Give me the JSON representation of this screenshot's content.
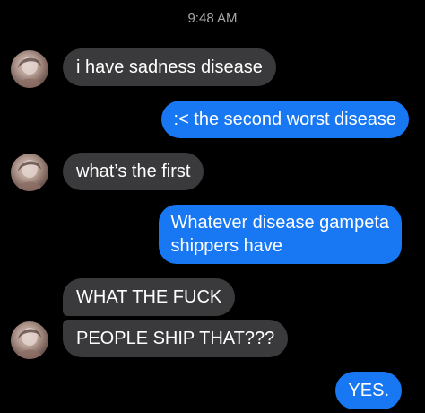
{
  "conversation": {
    "timestamp": "9:48 AM",
    "messages": [
      {
        "sender": "them",
        "text": "i have sadness disease"
      },
      {
        "sender": "me",
        "text": ":< the second worst disease"
      },
      {
        "sender": "them",
        "text": "what’s the first"
      },
      {
        "sender": "me",
        "lines": [
          "Whatever disease gampeta",
          "shippers have"
        ]
      },
      {
        "sender": "them",
        "text": "WHAT THE FUCK"
      },
      {
        "sender": "them",
        "text": "PEOPLE SHIP THAT???"
      },
      {
        "sender": "me",
        "text": "YES."
      }
    ]
  },
  "colors": {
    "background": "#000000",
    "incoming_bubble": "#3a3a3c",
    "outgoing_bubble": "#1877f2",
    "timestamp_text": "#a8a8a8"
  }
}
